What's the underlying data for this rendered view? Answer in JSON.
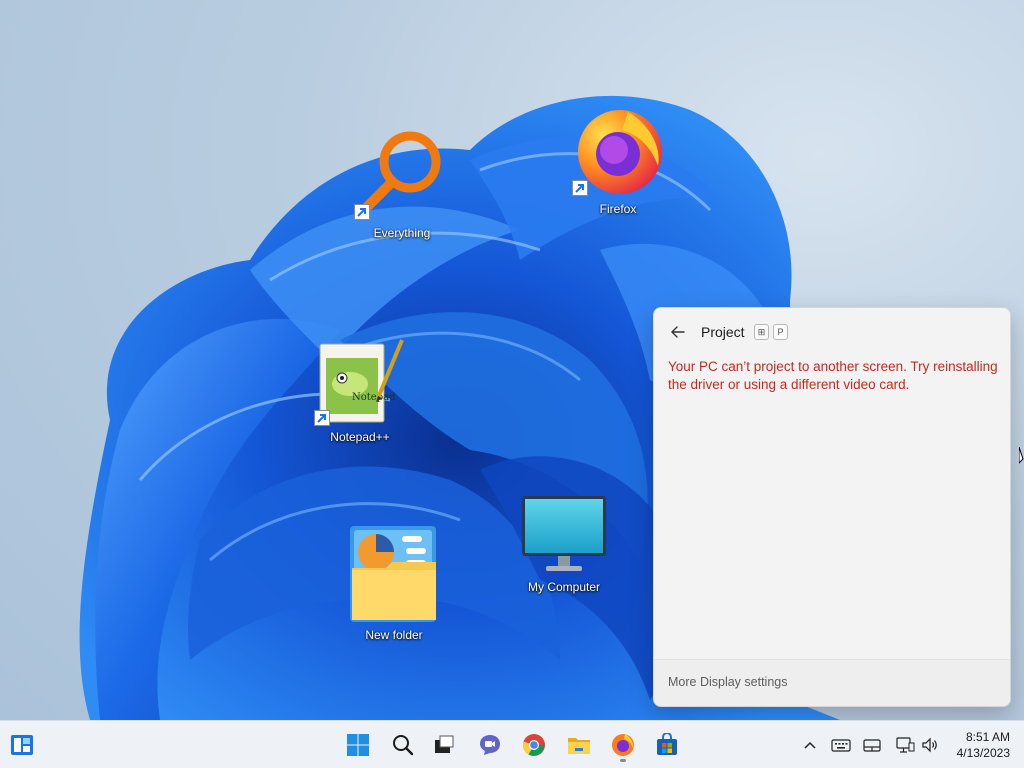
{
  "desktop": {
    "icons": [
      {
        "label": "Everything",
        "icon": "everything-search-icon"
      },
      {
        "label": "Firefox",
        "icon": "firefox-icon"
      },
      {
        "label": "Notepad++",
        "icon": "notepad-plus-plus-icon"
      },
      {
        "label": "My Computer",
        "icon": "monitor-icon"
      },
      {
        "label": "New folder",
        "icon": "folder-icon"
      }
    ]
  },
  "project_flyout": {
    "title": "Project",
    "shortcut_keys": [
      "⊞",
      "P"
    ],
    "error_message": "Your PC can’t project to another screen. Try reinstalling the driver or using a different video card.",
    "footer_link": "More Display settings",
    "error_color": "#c42b1c"
  },
  "taskbar": {
    "apps": [
      "widgets-icon",
      "start-icon",
      "search-icon",
      "task-view-icon",
      "teams-chat-icon",
      "chrome-icon",
      "file-explorer-icon",
      "firefox-icon",
      "store-icon"
    ],
    "tray": [
      "chevron-up-icon",
      "keyboard-icon",
      "touchpad-icon",
      "network-icon",
      "volume-icon"
    ],
    "time": "8:51 AM",
    "date": "4/13/2023"
  },
  "colors": {
    "accent": "#0067c0",
    "wallpaper_blue": "#1f6fe0"
  }
}
